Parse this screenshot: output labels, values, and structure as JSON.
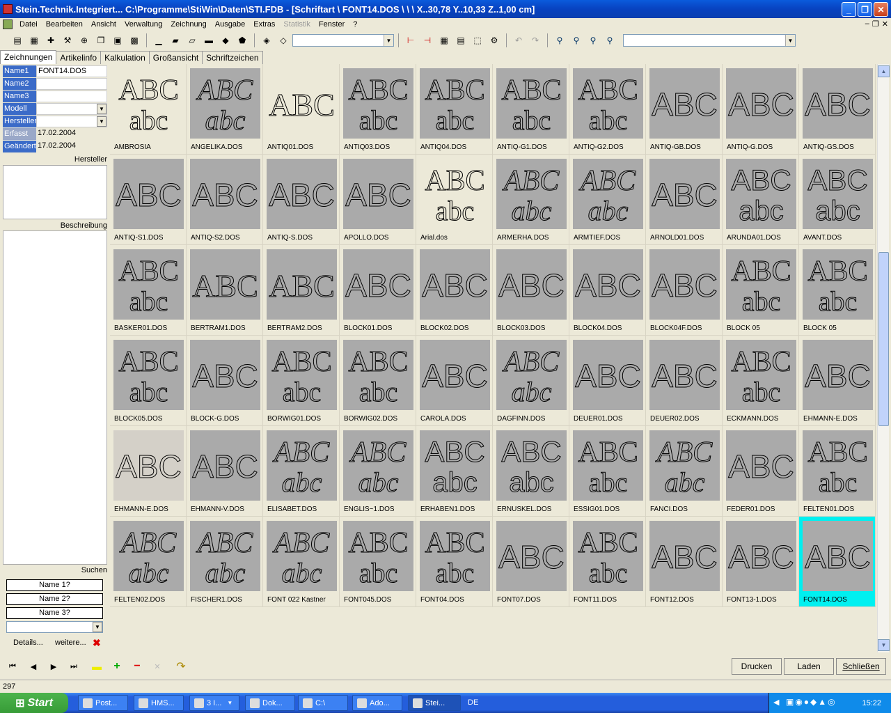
{
  "window": {
    "title": "Stein.Technik.Integriert...   C:\\Programme\\StiWin\\Daten\\STI.FDB - [Schriftart \\ FONT14.DOS \\  \\  \\ X..30,78  Y..10,33  Z..1,00 cm]"
  },
  "menu": [
    "Datei",
    "Bearbeiten",
    "Ansicht",
    "Verwaltung",
    "Zeichnung",
    "Ausgabe",
    "Extras",
    "Statistik",
    "Fenster",
    "?"
  ],
  "tabs": [
    "Zeichnungen",
    "Artikelinfo",
    "Kalkulation",
    "Großansicht",
    "Schriftzeichen"
  ],
  "fields": [
    {
      "label": "Name1",
      "value": "FONT14.DOS"
    },
    {
      "label": "Name2",
      "value": ""
    },
    {
      "label": "Name3",
      "value": ""
    },
    {
      "label": "Modell",
      "value": ""
    },
    {
      "label": "Hersteller",
      "value": ""
    },
    {
      "label": "Erfasst",
      "value": "17.02.2004"
    },
    {
      "label": "Geändert",
      "value": "17.02.2004"
    }
  ],
  "sections": {
    "hersteller": "Hersteller",
    "beschreibung": "Beschreibung",
    "suchen": "Suchen"
  },
  "search": {
    "name1": "Name 1?",
    "name2": "Name 2?",
    "name3": "Name 3?",
    "details": "Details...",
    "weitere": "weitere..."
  },
  "fonts": [
    "AMBROSIA",
    "ANGELIKA.DOS",
    "ANTIQ01.DOS",
    "ANTIQ03.DOS",
    "ANTIQ04.DOS",
    "ANTIQ-G1.DOS",
    "ANTIQ-G2.DOS",
    "ANTIQ-GB.DOS",
    "ANTIQ-G.DOS",
    "ANTIQ-GS.DOS",
    "ANTIQ-S1.DOS",
    "ANTIQ-S2.DOS",
    "ANTIQ-S.DOS",
    "APOLLO.DOS",
    "Arial.dos",
    "ARMERHA.DOS",
    "ARMTIEF.DOS",
    "ARNOLD01.DOS",
    "ARUNDA01.DOS",
    "AVANT.DOS",
    "BASKER01.DOS",
    "BERTRAM1.DOS",
    "BERTRAM2.DOS",
    "BLOCK01.DOS",
    "BLOCK02.DOS",
    "BLOCK03.DOS",
    "BLOCK04.DOS",
    "BLOCK04F.DOS",
    "BLOCK 05",
    "BLOCK 05",
    "BLOCK05.DOS",
    "BLOCK-G.DOS",
    "BORWIG01.DOS",
    "BORWIG02.DOS",
    "CAROLA.DOS",
    "DAGFINN.DOS",
    "DEUER01.DOS",
    "DEUER02.DOS",
    "ECKMANN.DOS",
    "EHMANN-E.DOS",
    "EHMANN-E.DOS",
    "EHMANN-V.DOS",
    "ELISABET.DOS",
    "ENGLIS~1.DOS",
    "ERHABEN1.DOS",
    "ERNUSKEL.DOS",
    "ESSIG01.DOS",
    "FANCI.DOS",
    "FEDER01.DOS",
    "FELTEN01.DOS",
    "FELTEN02.DOS",
    "FISCHER1.DOS",
    "FONT 022 Kastner",
    "FONT045.DOS",
    "FONT04.DOS",
    "FONT07.DOS",
    "FONT11.DOS",
    "FONT12.DOS",
    "FONT13-1.DOS",
    "FONT14.DOS"
  ],
  "thumb_upper": "ABC",
  "thumb_lower": "abc",
  "buttons": {
    "drucken": "Drucken",
    "laden": "Laden",
    "schliessen": "Schließen"
  },
  "status": {
    "count": "297"
  },
  "taskbar": {
    "start": "Start",
    "tasks": [
      "Post...",
      "HMS...",
      "3 I...",
      "Dok...",
      "C:\\",
      "Ado...",
      "Stei..."
    ],
    "lang": "DE",
    "clock": "15:22"
  },
  "colors": {
    "selected": "#00F0F0",
    "thumb": "#AAAAAA",
    "titlebar": "#0A5BDC"
  }
}
